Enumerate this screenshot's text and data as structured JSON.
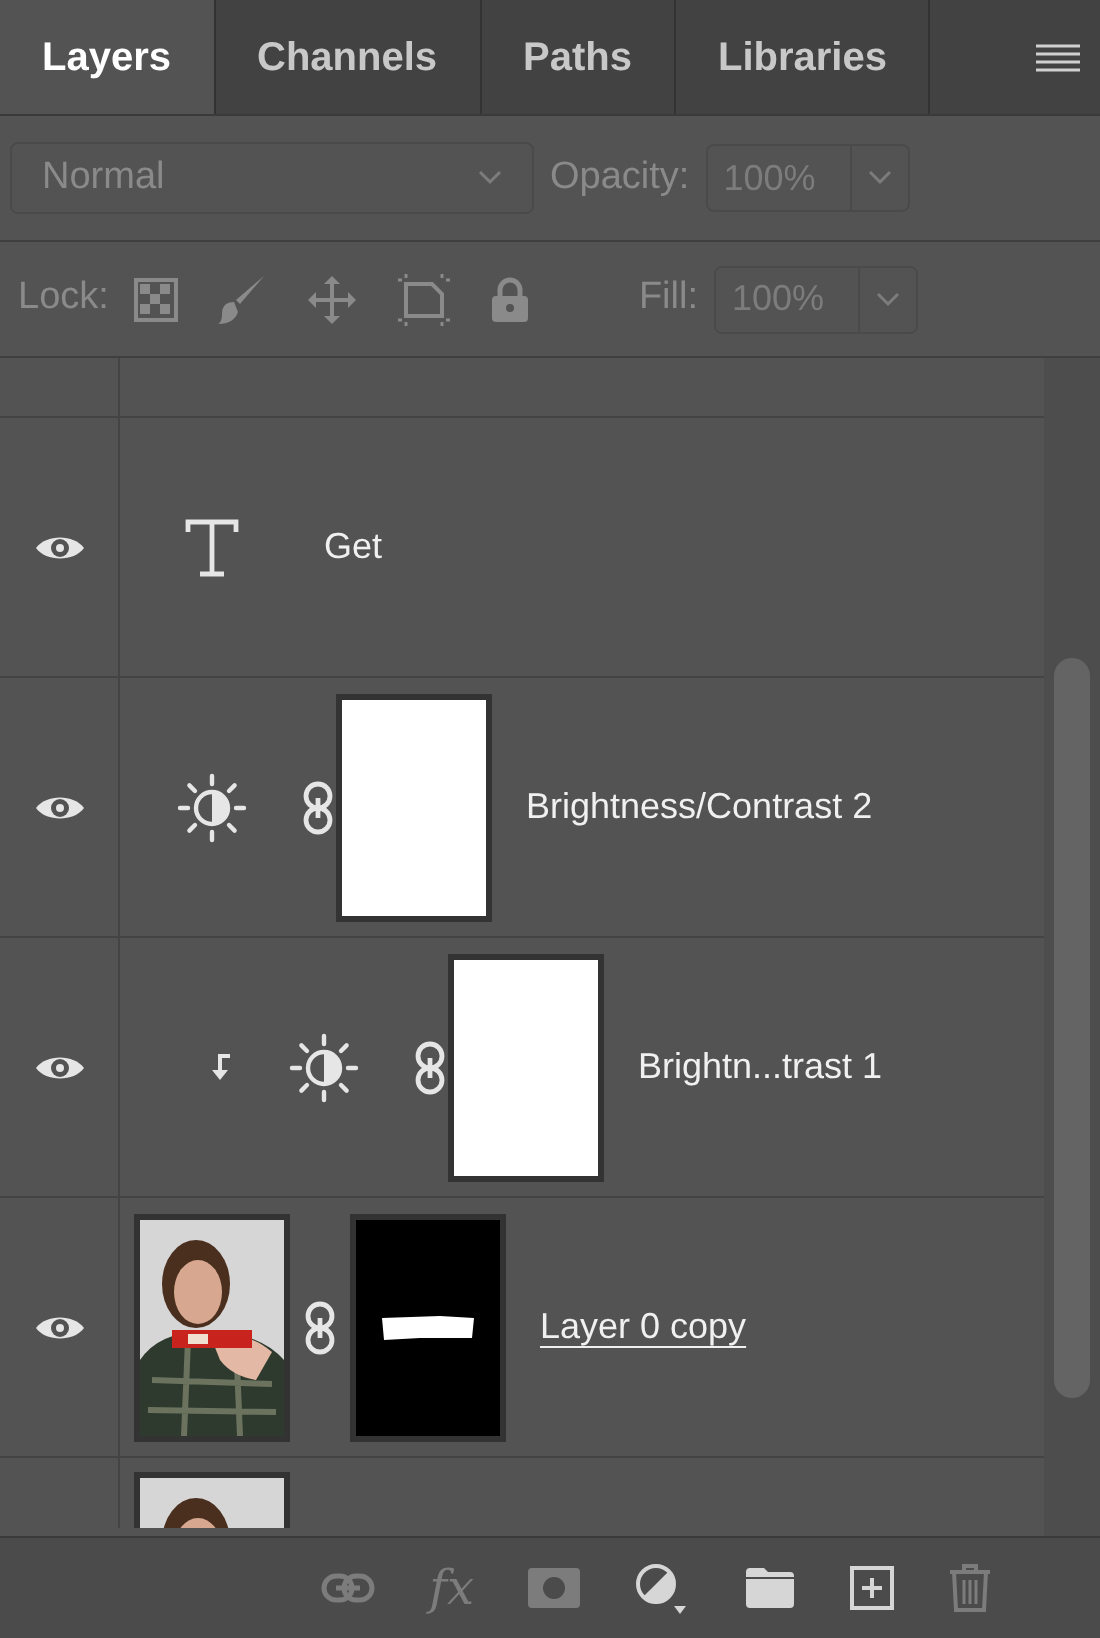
{
  "tabs": [
    {
      "label": "Layers",
      "selected": true
    },
    {
      "label": "Channels",
      "selected": false
    },
    {
      "label": "Paths",
      "selected": false
    },
    {
      "label": "Libraries",
      "selected": false
    }
  ],
  "blend": {
    "value": "Normal",
    "opacity_label": "Opacity:",
    "opacity": "100%"
  },
  "lock": {
    "label": "Lock:",
    "fill_label": "Fill:",
    "fill": "100%"
  },
  "layers": [
    {
      "kind": "text",
      "name": "Get",
      "visible": true,
      "underlined": false
    },
    {
      "kind": "adjustment",
      "name": "Brightness/Contrast 2",
      "visible": true,
      "clipped": false,
      "underlined": false
    },
    {
      "kind": "adjustment",
      "name": "Brightn...trast 1",
      "visible": true,
      "clipped": true,
      "underlined": false
    },
    {
      "kind": "pixel",
      "name": "Layer 0 copy",
      "visible": true,
      "underlined": true
    },
    {
      "kind": "pixel_partial"
    }
  ],
  "footer": {
    "fx": "fx"
  }
}
